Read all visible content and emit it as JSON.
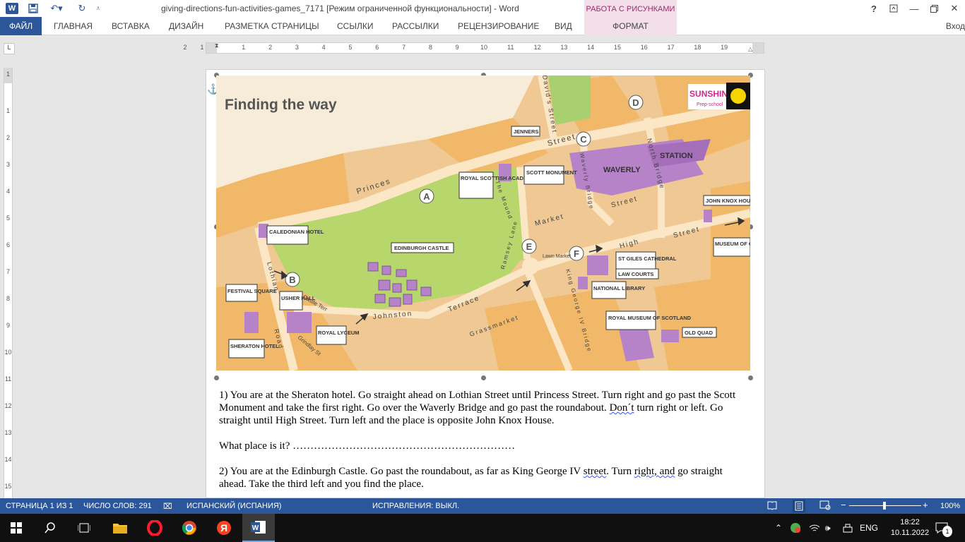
{
  "window": {
    "title": "giving-directions-fun-activities-games_7171 [Режим ограниченной функциональности] - Word",
    "context_group": "РАБОТА С РИСУНКАМИ",
    "help": "?",
    "signin": "Вход"
  },
  "ribbon": {
    "tabs": [
      "ФАЙЛ",
      "ГЛАВНАЯ",
      "ВСТАВКА",
      "ДИЗАЙН",
      "РАЗМЕТКА СТРАНИЦЫ",
      "ССЫЛКИ",
      "РАССЫЛКИ",
      "РЕЦЕНЗИРОВАНИЕ",
      "ВИД",
      "ФОРМАТ"
    ]
  },
  "ruler": {
    "h_numbers": [
      "2",
      "1",
      "1",
      "2",
      "3",
      "4",
      "5",
      "6",
      "7",
      "8",
      "9",
      "10",
      "11",
      "12",
      "13",
      "14",
      "15",
      "16",
      "17",
      "18",
      "19"
    ],
    "v_numbers": [
      "1",
      "1",
      "2",
      "3",
      "4",
      "5",
      "6",
      "7",
      "8",
      "9",
      "10",
      "11",
      "12",
      "13",
      "14",
      "15"
    ]
  },
  "map": {
    "title": "Finding the way",
    "logo": "SUNSHINE",
    "logo_sub": "Prep-school",
    "points": [
      "A",
      "B",
      "C",
      "D",
      "E",
      "F"
    ],
    "places": [
      "JENNERS",
      "ROYAL SCOTTISH ACADEMY",
      "SCOTT MONUMENT",
      "WAVERLY",
      "STATION",
      "JOHN KNOX HOU",
      "CALEDONIAN HOTEL",
      "EDINBURGH CASTLE",
      "ST GILES CATHEDRAL",
      "LAW COURTS",
      "MUSEUM OF CHILDHOOD",
      "FESTIVAL SQUARE",
      "USHER HALL",
      "NATIONAL LIBRARY",
      "ROYAL MUSEUM OF SCOTLAND",
      "SHERATON HOTEL",
      "ROYAL LYCEUM",
      "OLD QUAD"
    ],
    "streets": [
      "Princes",
      "Street",
      "David's Street",
      "Waverly Bridge",
      "North Bridge",
      "Street",
      "The Mound",
      "Market",
      "Ramsey Lane",
      "Lawn Market",
      "High",
      "Street",
      "Lothian",
      "Road",
      "Castle Terr",
      "Johnston",
      "Terrace",
      "Grassmarket",
      "King George IV Bridge",
      "Grindlay St"
    ]
  },
  "document": {
    "p1": "1) You are at the Sheraton hotel. Go straight ahead on Lothian Street until Princess Street. Turn right and go past the Scott Monument and take the first right. Go over the Waverly Bridge and go past the roundabout.",
    "p1_sq": "Don´t",
    "p1_end": "turn right or left. Go straight until High Street. Turn left and the place is opposite John Knox House.",
    "q1": "What place is it? ………………………………………………………",
    "p2a": "2) You are at the Edinburgh Castle. Go past the roundabout, as far as King George IV",
    "p2_sq1": "street",
    "p2b": ". Turn",
    "p2_sq2": "right, and",
    "p2c": "go straight ahead. Take the third left and you find the place."
  },
  "status": {
    "page": "СТРАНИЦА 1 ИЗ 1",
    "words": "ЧИСЛО СЛОВ: 291",
    "language": "ИСПАНСКИЙ (ИСПАНИЯ)",
    "track": "ИСПРАВЛЕНИЯ: ВЫКЛ.",
    "zoom": "100%",
    "zoom_level": 100
  },
  "taskbar": {
    "lang": "ENG",
    "time": "18:22",
    "date": "10.11.2022",
    "notif_count": "1"
  }
}
